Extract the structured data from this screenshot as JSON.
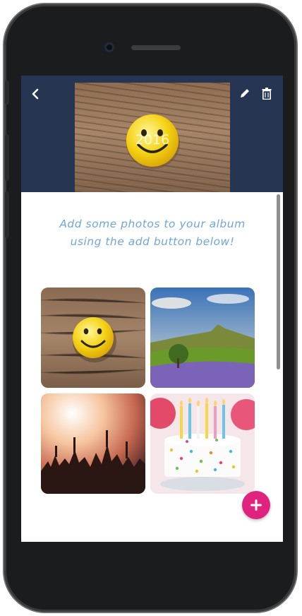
{
  "header": {
    "back_icon": "chevron-left-icon",
    "edit_icon": "pencil-icon",
    "delete_icon": "trash-icon",
    "cover_photo": "smiley-on-wood",
    "cover_overlay_text": "2016"
  },
  "empty_state": {
    "message": "Add some photos to your album using the add button below!"
  },
  "photos": [
    {
      "subject": "smiley-on-wood"
    },
    {
      "subject": "green-hill-landscape"
    },
    {
      "subject": "concert-crowd"
    },
    {
      "subject": "birthday-cake"
    }
  ],
  "fab": {
    "icon": "plus-icon"
  },
  "colors": {
    "header_bg": "#253552",
    "message_text": "#6ea7d8",
    "fab_bg": "#e0237e"
  }
}
